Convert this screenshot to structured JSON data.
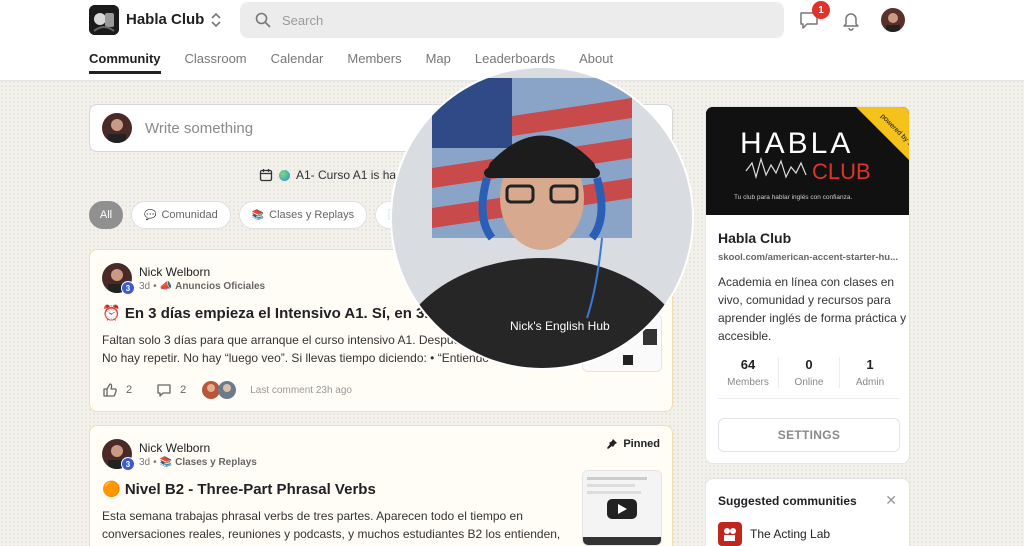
{
  "header": {
    "group_name": "Habla Club",
    "search_placeholder": "Search",
    "notification_count": "1"
  },
  "tabs": [
    {
      "label": "Community",
      "active": true
    },
    {
      "label": "Classroom"
    },
    {
      "label": "Calendar"
    },
    {
      "label": "Members"
    },
    {
      "label": "Map"
    },
    {
      "label": "Leaderboards"
    },
    {
      "label": "About"
    }
  ],
  "composer": {
    "placeholder": "Write something"
  },
  "event_banner": {
    "text": "A1- Curso A1 is ha"
  },
  "filters": [
    {
      "label": "All"
    },
    {
      "label": "Comunidad"
    },
    {
      "label": "Clases y Replays"
    },
    {
      "label": "Ta"
    }
  ],
  "posts": [
    {
      "author": "Nick Welborn",
      "level": "3",
      "time": "3d",
      "category": "Anuncios Oficiales",
      "title": "⏰ En 3 días empieza el Intensivo A1. Sí, en 3. I",
      "body_line1": "Faltan solo 3 días para que arranque el curso intensivo A1. Despuc",
      "body_line2": "No hay repetir. No hay “luego veo”. Si llevas tiempo diciendo: • “Entiendo",
      "likes": "2",
      "comments": "2",
      "last_comment": "Last comment 23h ago"
    },
    {
      "author": "Nick Welborn",
      "level": "3",
      "time": "3d",
      "category": "Clases y Replays",
      "pinned_label": "Pinned",
      "title": "🟠 Nivel B2 - Three-Part Phrasal Verbs",
      "body_line1": "Esta semana trabajas phrasal verbs de tres partes. Aparecen todo el tiempo en",
      "body_line2": "conversaciones reales, reuniones y podcasts, y muchos estudiantes B2 los entienden,"
    }
  ],
  "sidebar": {
    "cover_title": "HABLA",
    "cover_title2": "CLUB",
    "cover_tagline": "Tu club para hablar inglés con confianza.",
    "ribbon": "powered by skool",
    "name": "Habla Club",
    "url": "skool.com/american-accent-starter-hu...",
    "description": "Academia en línea con clases en vivo, comunidad y recursos para aprender inglés de forma práctica y accesible.",
    "stats": [
      {
        "value": "64",
        "label": "Members"
      },
      {
        "value": "0",
        "label": "Online"
      },
      {
        "value": "1",
        "label": "Admin"
      }
    ],
    "settings_label": "SETTINGS"
  },
  "suggested": {
    "heading": "Suggested communities",
    "items": [
      {
        "name": "The Acting Lab"
      }
    ]
  },
  "webcam": {
    "shirt_text": "Nick's English Hub"
  },
  "colors": {
    "accent": "#e0322a",
    "post_border": "#f0dfae",
    "level_badge": "#3b5bd0"
  }
}
